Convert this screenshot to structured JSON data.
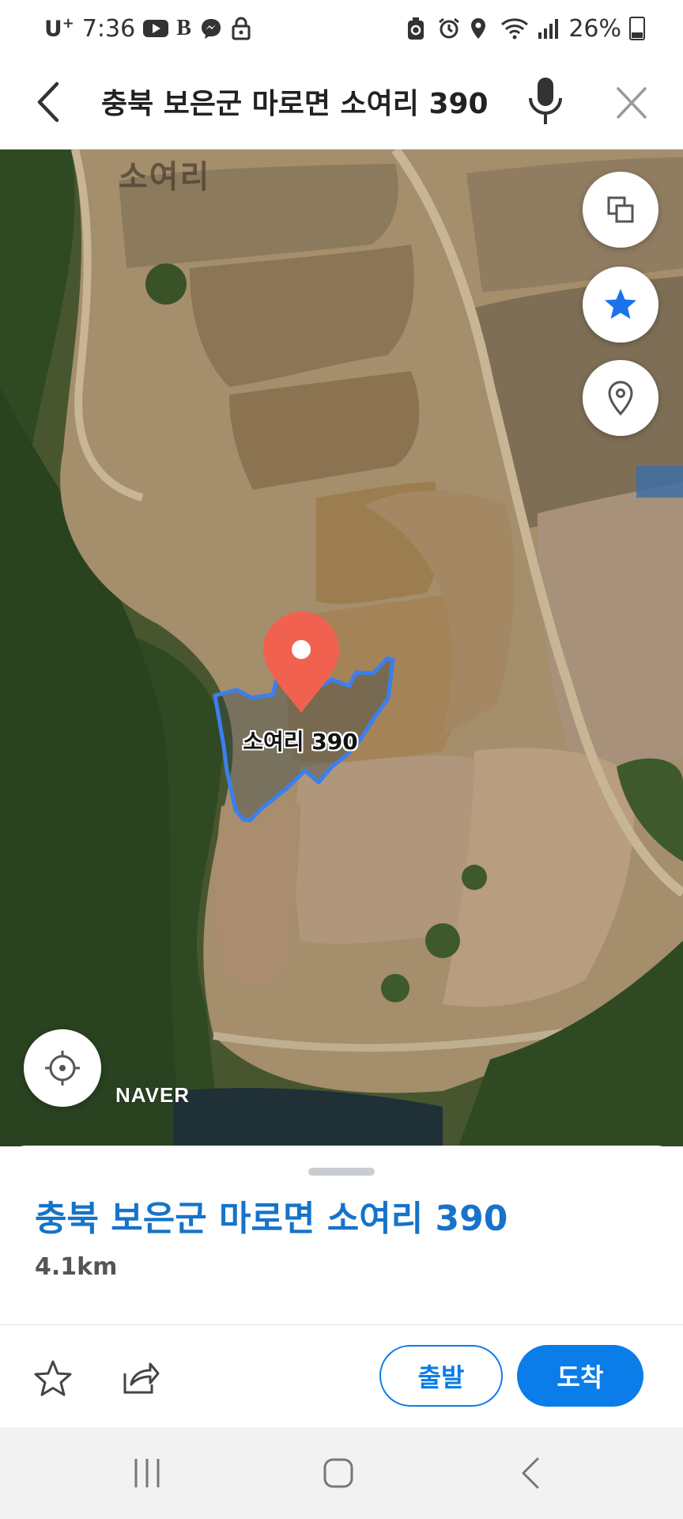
{
  "status_bar": {
    "carrier": "U",
    "carrier_sup": "+",
    "time": "7:36",
    "left_icons": [
      "youtube-icon",
      "b-app-icon",
      "messenger-icon",
      "lock-icon"
    ],
    "right_icons": [
      "recycle-icon",
      "alarm-icon",
      "location-icon",
      "wifi-icon",
      "signal-icon"
    ],
    "battery": "26%"
  },
  "search": {
    "query": "충북 보은군 마로면 소여리 390",
    "icons": {
      "back": "back-arrow-icon",
      "mic": "mic-icon",
      "close": "close-icon"
    }
  },
  "map": {
    "area_label": "소여리",
    "marker_label": "소여리 390",
    "logo": "NAVER",
    "controls": [
      "layers-icon",
      "star-icon",
      "pin-outline-icon",
      "locate-icon"
    ],
    "accent_color": "#3b7ff0",
    "marker_color": "#f0624f"
  },
  "sheet": {
    "title": "충북 보은군 마로면 소여리 390",
    "distance": "4.1km",
    "depart_label": "출발",
    "arrive_label": "도착",
    "title_color": "#1673c9",
    "button_color": "#0a7de8"
  },
  "nav_bar": {
    "icons": [
      "recent-apps-icon",
      "home-icon",
      "back-icon"
    ]
  }
}
